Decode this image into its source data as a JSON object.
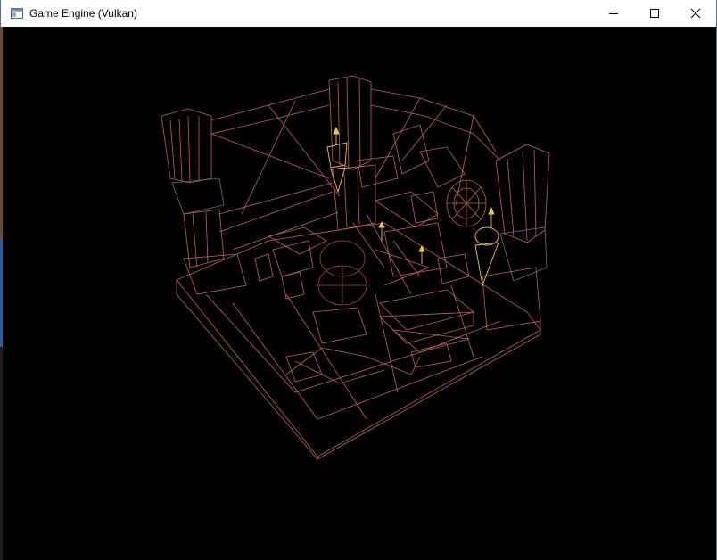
{
  "window": {
    "title": "Game Engine (Vulkan)",
    "app_icon": "window-app-icon",
    "buttons": [
      {
        "name": "minimize-button",
        "icon": "minimize-icon"
      },
      {
        "name": "maximize-button",
        "icon": "maximize-icon"
      },
      {
        "name": "close-button",
        "icon": "close-icon"
      }
    ]
  },
  "viewport": {
    "render_mode": "wireframe",
    "background": "#000000",
    "wire_color_warm": "#e07a5f",
    "wire_color_highlight": "#f2c14e",
    "wire_color_cool": "#7a6fa0"
  }
}
